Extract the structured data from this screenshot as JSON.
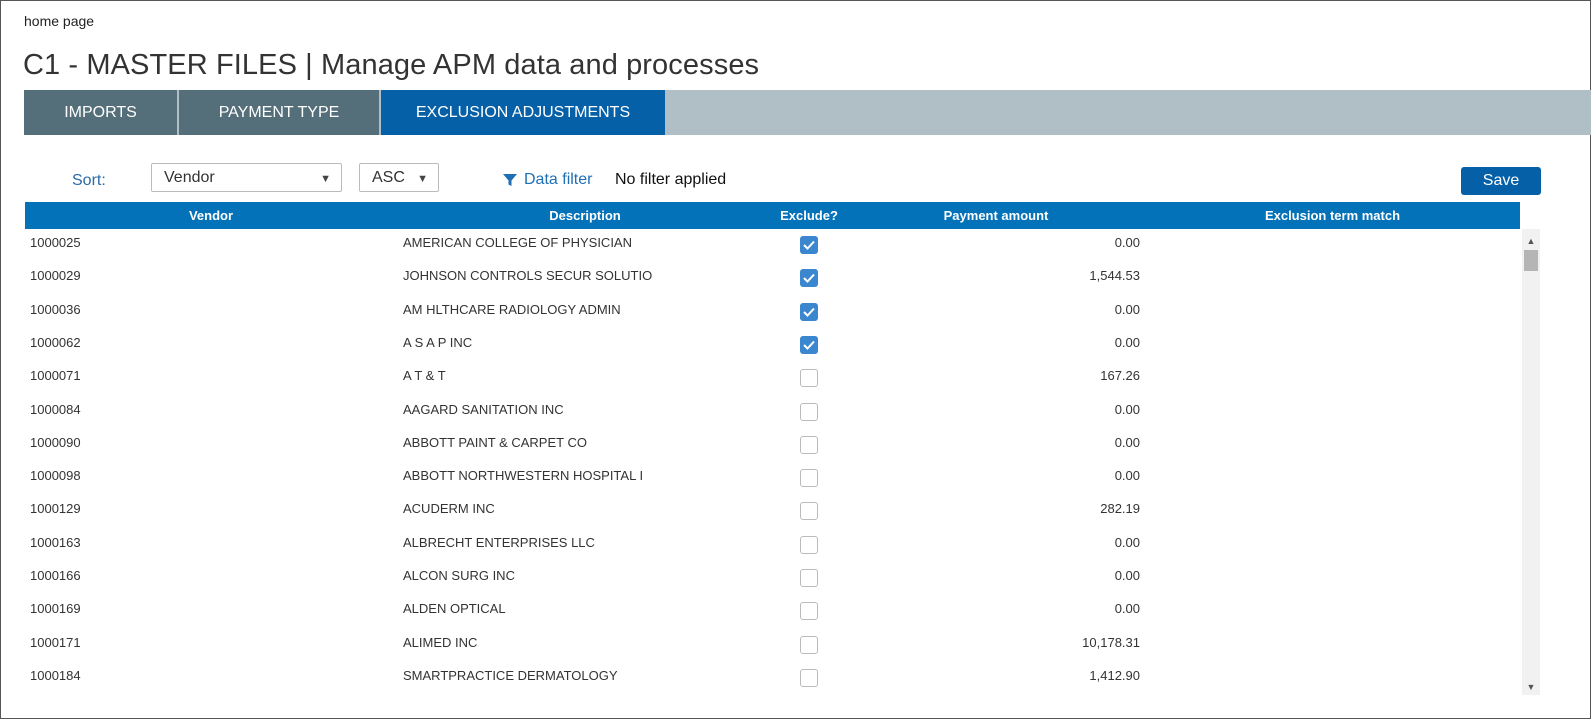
{
  "breadcrumb": "home page",
  "page_title": "C1 - MASTER FILES | Manage APM data and processes",
  "tabs": [
    {
      "label": "IMPORTS",
      "active": false
    },
    {
      "label": "PAYMENT TYPE",
      "active": false
    },
    {
      "label": "EXCLUSION ADJUSTMENTS",
      "active": true
    }
  ],
  "toolbar": {
    "sort_label": "Sort:",
    "sort_field": "Vendor",
    "sort_order": "ASC",
    "filter_link": "Data filter",
    "filter_status": "No filter applied",
    "save_label": "Save"
  },
  "table": {
    "columns": [
      "Vendor",
      "Description",
      "Exclude?",
      "Payment amount",
      "Exclusion term match"
    ],
    "rows": [
      {
        "vendor": "1000025",
        "description": "AMERICAN COLLEGE OF PHYSICIAN",
        "exclude": true,
        "amount": "0.00",
        "term": ""
      },
      {
        "vendor": "1000029",
        "description": "JOHNSON CONTROLS SECUR SOLUTIO",
        "exclude": true,
        "amount": "1,544.53",
        "term": ""
      },
      {
        "vendor": "1000036",
        "description": "AM HLTHCARE RADIOLOGY ADMIN",
        "exclude": true,
        "amount": "0.00",
        "term": ""
      },
      {
        "vendor": "1000062",
        "description": "A S A P INC",
        "exclude": true,
        "amount": "0.00",
        "term": ""
      },
      {
        "vendor": "1000071",
        "description": "A T & T",
        "exclude": false,
        "amount": "167.26",
        "term": ""
      },
      {
        "vendor": "1000084",
        "description": "AAGARD SANITATION INC",
        "exclude": false,
        "amount": "0.00",
        "term": ""
      },
      {
        "vendor": "1000090",
        "description": "ABBOTT PAINT & CARPET CO",
        "exclude": false,
        "amount": "0.00",
        "term": ""
      },
      {
        "vendor": "1000098",
        "description": "ABBOTT NORTHWESTERN HOSPITAL I",
        "exclude": false,
        "amount": "0.00",
        "term": ""
      },
      {
        "vendor": "1000129",
        "description": "ACUDERM INC",
        "exclude": false,
        "amount": "282.19",
        "term": ""
      },
      {
        "vendor": "1000163",
        "description": "ALBRECHT ENTERPRISES LLC",
        "exclude": false,
        "amount": "0.00",
        "term": ""
      },
      {
        "vendor": "1000166",
        "description": "ALCON SURG INC",
        "exclude": false,
        "amount": "0.00",
        "term": ""
      },
      {
        "vendor": "1000169",
        "description": "ALDEN OPTICAL",
        "exclude": false,
        "amount": "0.00",
        "term": ""
      },
      {
        "vendor": "1000171",
        "description": "ALIMED INC",
        "exclude": false,
        "amount": "10,178.31",
        "term": ""
      },
      {
        "vendor": "1000184",
        "description": "SMARTPRACTICE DERMATOLOGY",
        "exclude": false,
        "amount": "1,412.90",
        "term": ""
      }
    ]
  },
  "colors": {
    "header_blue": "#0472b9",
    "tab_active": "#0560a8",
    "tab_inactive": "#546e7a",
    "tab_strip": "#b0bec5",
    "checkbox_checked": "#3a86cf"
  }
}
